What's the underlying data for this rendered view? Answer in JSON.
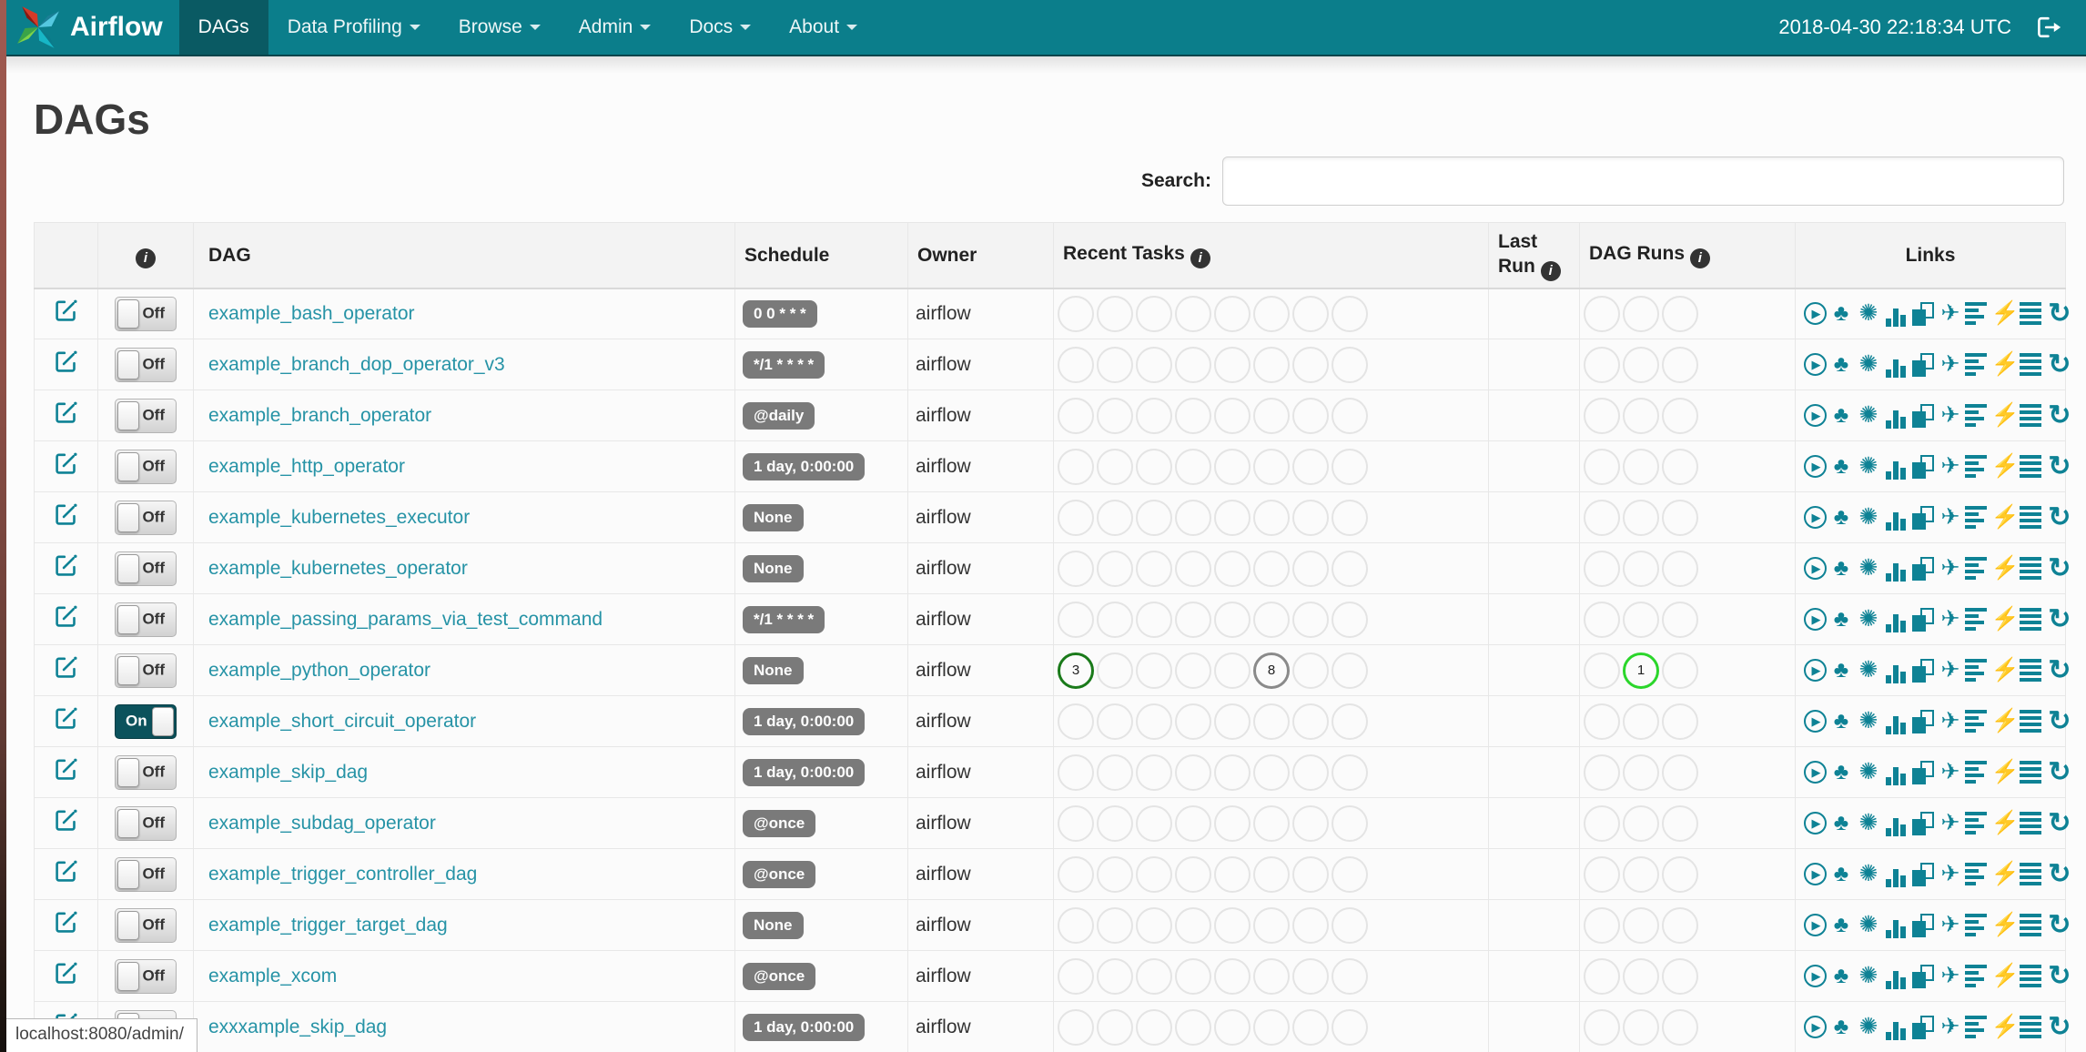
{
  "navbar": {
    "brand": "Airflow",
    "items": [
      {
        "label": "DAGs",
        "active": true
      },
      {
        "label": "Data Profiling",
        "caret": true
      },
      {
        "label": "Browse",
        "caret": true
      },
      {
        "label": "Admin",
        "caret": true
      },
      {
        "label": "Docs",
        "caret": true
      },
      {
        "label": "About",
        "caret": true
      }
    ],
    "clock": "2018-04-30 22:18:34 UTC",
    "logout_icon": "sign-out-icon"
  },
  "page": {
    "title": "DAGs",
    "search_label": "Search:",
    "search_value": "",
    "status_bar": "localhost:8080/admin/"
  },
  "table": {
    "headers": {
      "info_glyph": "i",
      "dag": "DAG",
      "schedule": "Schedule",
      "owner": "Owner",
      "recent_tasks": "Recent Tasks",
      "last_run": "Last Run",
      "dag_runs": "DAG Runs",
      "links": "Links"
    },
    "recent_task_slots": 8,
    "dag_run_slots": 3,
    "rows": [
      {
        "dag": "example_bash_operator",
        "toggle": "Off",
        "schedule": "0 0 * * *",
        "owner": "airflow",
        "last_run": "",
        "recent_tasks": [],
        "dag_runs": []
      },
      {
        "dag": "example_branch_dop_operator_v3",
        "toggle": "Off",
        "schedule": "*/1 * * * *",
        "owner": "airflow",
        "last_run": "",
        "recent_tasks": [],
        "dag_runs": []
      },
      {
        "dag": "example_branch_operator",
        "toggle": "Off",
        "schedule": "@daily",
        "owner": "airflow",
        "last_run": "",
        "recent_tasks": [],
        "dag_runs": []
      },
      {
        "dag": "example_http_operator",
        "toggle": "Off",
        "schedule": "1 day, 0:00:00",
        "owner": "airflow",
        "last_run": "",
        "recent_tasks": [],
        "dag_runs": []
      },
      {
        "dag": "example_kubernetes_executor",
        "toggle": "Off",
        "schedule": "None",
        "owner": "airflow",
        "last_run": "",
        "recent_tasks": [],
        "dag_runs": []
      },
      {
        "dag": "example_kubernetes_operator",
        "toggle": "Off",
        "schedule": "None",
        "owner": "airflow",
        "last_run": "",
        "recent_tasks": [],
        "dag_runs": []
      },
      {
        "dag": "example_passing_params_via_test_command",
        "toggle": "Off",
        "schedule": "*/1 * * * *",
        "owner": "airflow",
        "last_run": "",
        "recent_tasks": [],
        "dag_runs": []
      },
      {
        "dag": "example_python_operator",
        "toggle": "Off",
        "schedule": "None",
        "owner": "airflow",
        "last_run": "",
        "recent_tasks": [
          {
            "slot": 0,
            "count": 3,
            "color": "#1a7a1a",
            "state": "success"
          },
          {
            "slot": 5,
            "count": 8,
            "color": "#8a8a8a",
            "state": "queued"
          }
        ],
        "dag_runs": [
          {
            "slot": 1,
            "count": 1,
            "color": "#2bd62b",
            "state": "running"
          }
        ]
      },
      {
        "dag": "example_short_circuit_operator",
        "toggle": "On",
        "schedule": "1 day, 0:00:00",
        "owner": "airflow",
        "last_run": "",
        "recent_tasks": [],
        "dag_runs": []
      },
      {
        "dag": "example_skip_dag",
        "toggle": "Off",
        "schedule": "1 day, 0:00:00",
        "owner": "airflow",
        "last_run": "",
        "recent_tasks": [],
        "dag_runs": []
      },
      {
        "dag": "example_subdag_operator",
        "toggle": "Off",
        "schedule": "@once",
        "owner": "airflow",
        "last_run": "",
        "recent_tasks": [],
        "dag_runs": []
      },
      {
        "dag": "example_trigger_controller_dag",
        "toggle": "Off",
        "schedule": "@once",
        "owner": "airflow",
        "last_run": "",
        "recent_tasks": [],
        "dag_runs": []
      },
      {
        "dag": "example_trigger_target_dag",
        "toggle": "Off",
        "schedule": "None",
        "owner": "airflow",
        "last_run": "",
        "recent_tasks": [],
        "dag_runs": []
      },
      {
        "dag": "example_xcom",
        "toggle": "Off",
        "schedule": "@once",
        "owner": "airflow",
        "last_run": "",
        "recent_tasks": [],
        "dag_runs": []
      },
      {
        "dag": "exxxample_skip_dag",
        "toggle": "Off",
        "schedule": "1 day, 0:00:00",
        "owner": "airflow",
        "last_run": "",
        "recent_tasks": [],
        "dag_runs": []
      }
    ],
    "links_icons": [
      {
        "name": "trigger-dag-icon",
        "type": "circled",
        "glyph": "▶"
      },
      {
        "name": "tree-view-icon",
        "type": "glyph",
        "glyph": "♣"
      },
      {
        "name": "graph-view-icon",
        "type": "glyph",
        "glyph": "✺"
      },
      {
        "name": "task-duration-icon",
        "type": "bars"
      },
      {
        "name": "task-tries-icon",
        "type": "copy"
      },
      {
        "name": "landing-times-icon",
        "type": "glyph",
        "glyph": "✈"
      },
      {
        "name": "gantt-view-icon",
        "type": "hlines"
      },
      {
        "name": "code-view-icon",
        "type": "glyph",
        "glyph": "⚡"
      },
      {
        "name": "logs-icon",
        "type": "hlines-equal"
      },
      {
        "name": "refresh-icon",
        "type": "glyph",
        "glyph": "↻"
      }
    ]
  },
  "colors": {
    "navbar_teal": "#0b7e8b",
    "active_tab_teal": "#0a5a63",
    "link_teal": "#2693a6",
    "icon_teal": "#0e8295",
    "badge_gray": "#7a7a7a",
    "toggle_on_teal": "#0b525c",
    "success_green": "#1a7a1a",
    "queued_gray": "#8a8a8a",
    "running_green": "#2bd62b"
  }
}
